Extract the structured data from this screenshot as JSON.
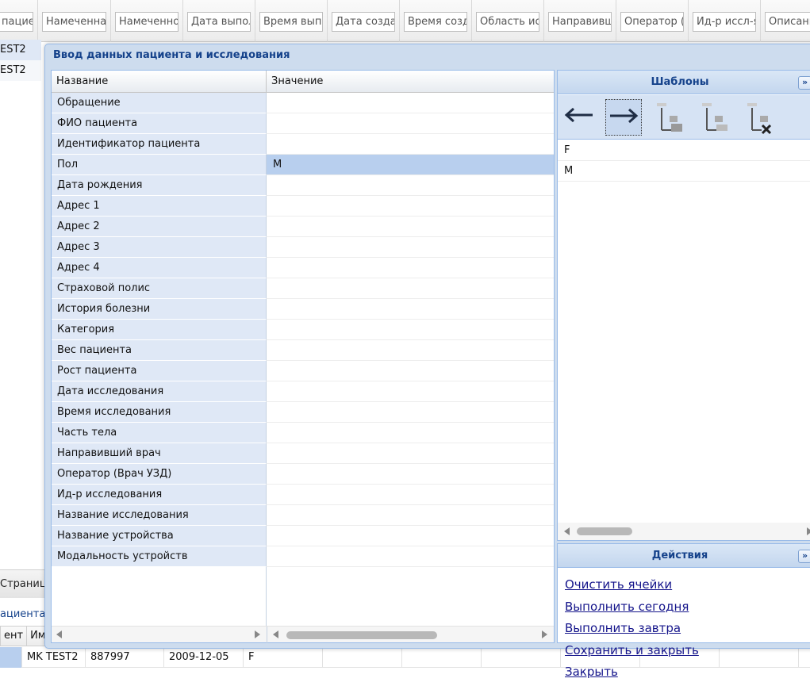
{
  "background": {
    "columns": [
      "пациен",
      "Намеченна",
      "Намеченно",
      "Дата выпол",
      "Время выпо",
      "Дата созда",
      "Время созд",
      "Область ис",
      "Направивш",
      "Оператор (",
      "Ид-р иссл-я",
      "Описани"
    ],
    "rows": [
      "EST2",
      "EST2"
    ],
    "pager_text": "Страница",
    "section_label": "ациента —",
    "sub_header": [
      "ент",
      "Имя"
    ],
    "bottom_row": [
      "MK TEST2",
      "887997",
      "2009-12-05",
      "F"
    ]
  },
  "dialog": {
    "title": "Ввод данных пациента и исследования",
    "grid": {
      "col_name": "Название",
      "col_value": "Значение",
      "rows": [
        {
          "name": "Обращение",
          "value": ""
        },
        {
          "name": "ФИО пациента",
          "value": ""
        },
        {
          "name": "Идентификатор пациента",
          "value": ""
        },
        {
          "name": "Пол",
          "value": "M"
        },
        {
          "name": "Дата рождения",
          "value": ""
        },
        {
          "name": "Адрес 1",
          "value": ""
        },
        {
          "name": "Адрес 2",
          "value": ""
        },
        {
          "name": "Адрес 3",
          "value": ""
        },
        {
          "name": "Адрес 4",
          "value": ""
        },
        {
          "name": "Страховой полис",
          "value": ""
        },
        {
          "name": "История болезни",
          "value": ""
        },
        {
          "name": "Категория",
          "value": ""
        },
        {
          "name": "Вес пациента",
          "value": ""
        },
        {
          "name": "Рост пациента",
          "value": ""
        },
        {
          "name": "Дата исследования",
          "value": ""
        },
        {
          "name": "Время исследования",
          "value": ""
        },
        {
          "name": "Часть тела",
          "value": ""
        },
        {
          "name": "Направивший врач",
          "value": ""
        },
        {
          "name": "Оператор (Врач УЗД)",
          "value": ""
        },
        {
          "name": "Ид-р исследования",
          "value": ""
        },
        {
          "name": "Название исследования",
          "value": ""
        },
        {
          "name": "Название устройства",
          "value": ""
        },
        {
          "name": "Модальность устройств",
          "value": ""
        }
      ],
      "selected_row": "Пол"
    },
    "templates": {
      "title": "Шаблоны",
      "items": [
        "F",
        "M"
      ],
      "toolbar": [
        "arrow-left-icon",
        "arrow-right-icon",
        "template-folder-add-icon",
        "template-folder-edit-icon",
        "template-folder-delete-icon"
      ]
    },
    "actions": {
      "title": "Действия",
      "links": [
        "Очистить ячейки",
        "Выполнить сегодня",
        "Выполнить завтра",
        "Сохранить и закрыть",
        "Закрыть"
      ]
    }
  },
  "colors": {
    "accent": "#15428b",
    "name_cell_bg": "#dfe8f6",
    "selected_bg": "#b8cfee",
    "panel_border": "#99bbe8",
    "link": "#15158b"
  }
}
